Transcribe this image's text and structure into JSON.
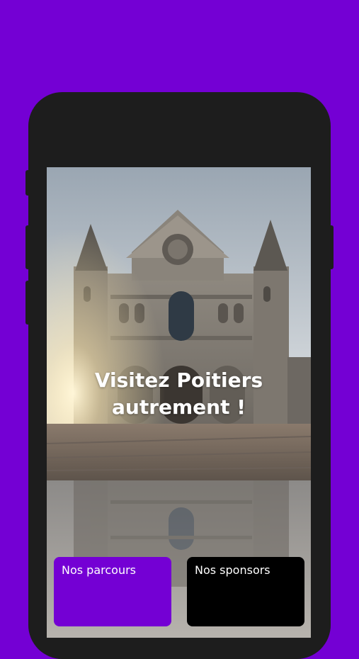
{
  "hero": {
    "headline_line1": "Visitez Poitiers",
    "headline_line2": "autrement !"
  },
  "actions": {
    "parcours_label": "Nos parcours",
    "sponsors_label": "Nos sponsors"
  },
  "colors": {
    "brand_purple": "#7400d4",
    "sponsor_card": "#000000",
    "phone_frame": "#1d1d1d"
  }
}
